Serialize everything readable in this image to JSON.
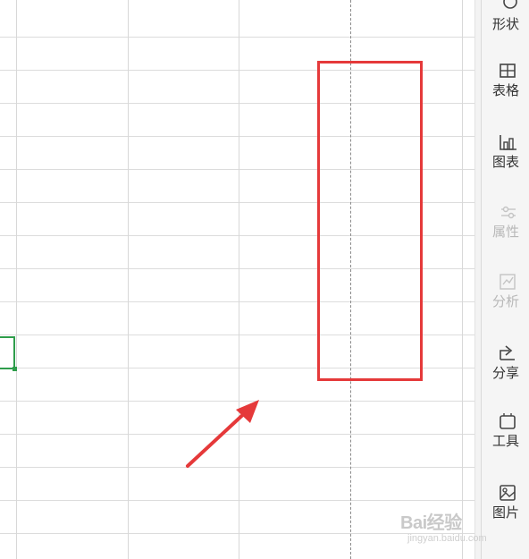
{
  "sidebar": {
    "items": [
      {
        "label": "形状",
        "icon": "shape-icon",
        "enabled": true
      },
      {
        "label": "表格",
        "icon": "table-icon",
        "enabled": true
      },
      {
        "label": "图表",
        "icon": "chart-icon",
        "enabled": true
      },
      {
        "label": "属性",
        "icon": "properties-icon",
        "enabled": false
      },
      {
        "label": "分析",
        "icon": "analysis-icon",
        "enabled": false
      },
      {
        "label": "分享",
        "icon": "share-icon",
        "enabled": true
      },
      {
        "label": "工具",
        "icon": "tools-icon",
        "enabled": true
      },
      {
        "label": "图片",
        "icon": "image-icon",
        "enabled": true
      }
    ]
  },
  "annotation": {
    "highlight_color": "#e5393a",
    "arrow_color": "#e5393a"
  },
  "selection": {
    "color": "#2e9d4b"
  },
  "watermark": {
    "brand": "Bai经验",
    "sub": "jingyan.baidu.com"
  }
}
